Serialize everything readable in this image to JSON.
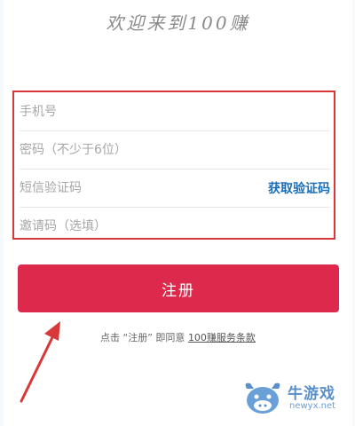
{
  "header": {
    "title": "欢迎来到100赚"
  },
  "form": {
    "phone_placeholder": "手机号",
    "password_placeholder": "密码（不少于6位）",
    "sms_placeholder": "短信验证码",
    "get_code_label": "获取验证码",
    "invite_placeholder": "邀请码（选填）"
  },
  "register": {
    "label": "注册"
  },
  "terms": {
    "prefix": "点击 “注册” 即同意",
    "link_label": "100赚服务条款"
  },
  "watermark": {
    "text": "牛游戏",
    "url": "newyx.net"
  },
  "colors": {
    "accent_red": "#dd2a4c",
    "highlight_border": "#d9383a",
    "link_blue": "#1b6fb8"
  }
}
